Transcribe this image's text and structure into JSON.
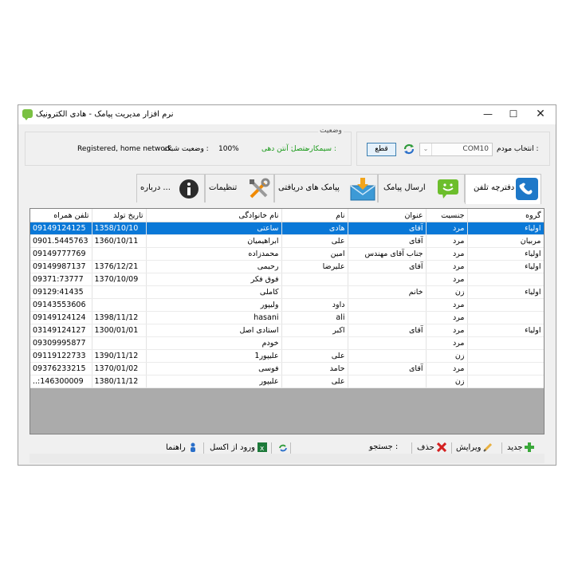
{
  "window": {
    "title": "نرم افزار مدیریت پیامک - هادی الکترونیک",
    "controls": {
      "minimize": "—",
      "maximize": "☐",
      "close": "✕"
    }
  },
  "status": {
    "legend": "وضعیت",
    "sim_label": "سیمکارت :",
    "sim_value": "متصل",
    "signal_label": "آنتن دهی :",
    "signal_value": "100%",
    "network_label": "وضعیت شبکه :",
    "network_value": "Registered, home network"
  },
  "modem": {
    "label": "انتخاب مودم :",
    "selected": "COM10",
    "disconnect_label": "قطع"
  },
  "tabs": [
    {
      "label": "دفترچه تلفن",
      "icon": "phone-icon",
      "active": true
    },
    {
      "label": "ارسال پیامک",
      "icon": "smile-message-icon",
      "active": false
    },
    {
      "label": "پیامک های دریافتی",
      "icon": "inbox-envelope-icon",
      "active": false
    },
    {
      "label": "تنظیمات",
      "icon": "tools-icon",
      "active": false
    },
    {
      "label": "درباره ...",
      "icon": "info-icon",
      "active": false
    }
  ],
  "table": {
    "headers": {
      "group": "گروه",
      "gender": "جنسیت",
      "title": "عنوان",
      "name": "نام",
      "family": "نام خانوادگی",
      "birth": "تاریخ تولد",
      "mobile": "تلفن همراه"
    },
    "rows": [
      {
        "group": "اولیاء",
        "gender": "مرد",
        "title": "آقای",
        "name": "هادی",
        "family": "ساعتی",
        "birth": "1358/10/10",
        "mobile": "09149124125",
        "selected": true
      },
      {
        "group": "مربیان",
        "gender": "مرد",
        "title": "آقای",
        "name": "علی",
        "family": "ابراهیمیان",
        "birth": "1360/10/11",
        "mobile": "0901.5445763"
      },
      {
        "group": "اولیاء",
        "gender": "مرد",
        "title": "جناب آقای مهندس",
        "name": "امین",
        "family": "محمدزاده",
        "birth": "",
        "mobile": "09149777769"
      },
      {
        "group": "اولیاء",
        "gender": "مرد",
        "title": "آقای",
        "name": "علیرضا",
        "family": "رحیمی",
        "birth": "1376/12/21",
        "mobile": "09149987137"
      },
      {
        "group": "",
        "gender": "مرد",
        "title": "",
        "name": "",
        "family": "فوق فکر",
        "birth": "1370/10/09",
        "mobile": "09371:73777"
      },
      {
        "group": "اولیاء",
        "gender": "زن",
        "title": "خانم",
        "name": "",
        "family": "کاملی",
        "birth": "",
        "mobile": "09129:41435"
      },
      {
        "group": "",
        "gender": "مرد",
        "title": "",
        "name": "داود",
        "family": "ولیپور",
        "birth": "",
        "mobile": "09143553606"
      },
      {
        "group": "",
        "gender": "مرد",
        "title": "",
        "name": "ali",
        "family": "hasani",
        "birth": "1398/11/12",
        "mobile": "09149124124"
      },
      {
        "group": "اولیاء",
        "gender": "مرد",
        "title": "آقای",
        "name": "اکبر",
        "family": "استادی اصل",
        "birth": "1300/01/01",
        "mobile": "03149124127"
      },
      {
        "group": "",
        "gender": "مرد",
        "title": "",
        "name": "",
        "family": "خودم",
        "birth": "",
        "mobile": "09309995877"
      },
      {
        "group": "",
        "gender": "زن",
        "title": "",
        "name": "علی",
        "family": "علیپور1",
        "birth": "1390/11/12",
        "mobile": "09119122733"
      },
      {
        "group": "",
        "gender": "مرد",
        "title": "آقای",
        "name": "حامد",
        "family": "فوسی",
        "birth": "1370/01/02",
        "mobile": "09376233215"
      },
      {
        "group": "",
        "gender": "زن",
        "title": "",
        "name": "علی",
        "family": "علیپور",
        "birth": "1380/11/12",
        "mobile": "..:146300009"
      }
    ]
  },
  "bottom": {
    "new_label": "جدید",
    "edit_label": "ویرایش",
    "delete_label": "حذف",
    "search_label": "جستجو :",
    "excel_label": "ورود از اکسل",
    "help_label": "راهنما"
  }
}
